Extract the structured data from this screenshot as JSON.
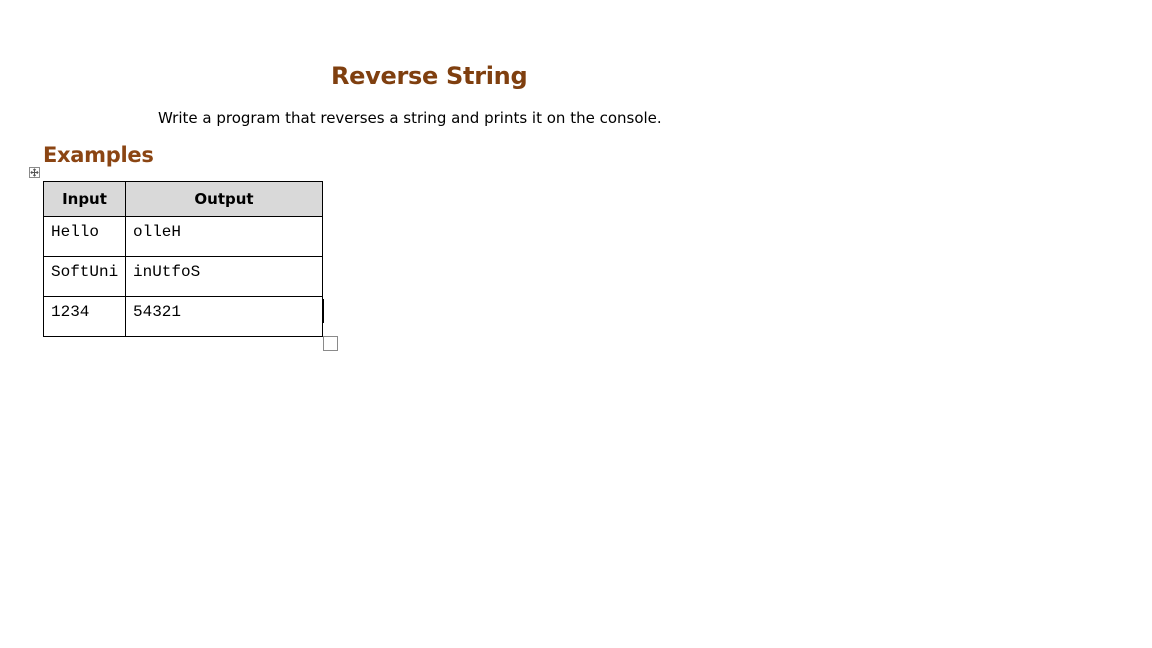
{
  "document": {
    "title": "Reverse String",
    "description": "Write a program that reverses a string and prints it on the console.",
    "section_heading": "Examples"
  },
  "examples_table": {
    "headers": [
      "Input",
      "Output"
    ],
    "rows": [
      [
        "Hello",
        "olleH"
      ],
      [
        "SoftUni",
        "inUtfoS"
      ],
      [
        "1234",
        "54321"
      ]
    ]
  },
  "colors": {
    "title": "#7f3f0f",
    "heading": "#8b4513",
    "header_fill": "#d9d9d9"
  },
  "icons": {
    "move_handle": "four-way-arrow-icon",
    "resize_handle": "table-resize-handle"
  }
}
